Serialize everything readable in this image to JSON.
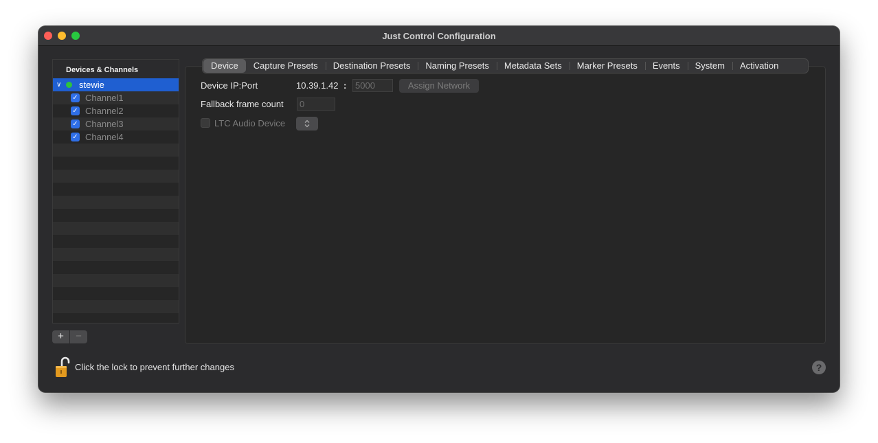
{
  "window": {
    "title": "Just Control Configuration"
  },
  "sidebar": {
    "header": "Devices & Channels",
    "device": {
      "name": "stewie",
      "status_color": "#2ec33c"
    },
    "channels": [
      "Channel1",
      "Channel2",
      "Channel3",
      "Channel4"
    ]
  },
  "tabs": [
    "Device",
    "Capture Presets",
    "Destination Presets",
    "Naming Presets",
    "Metadata Sets",
    "Marker Presets",
    "Events",
    "System",
    "Activation"
  ],
  "device": {
    "ip_label": "Device IP:Port",
    "ip_value": "10.39.1.42",
    "ip_separator": ":",
    "port_placeholder": "5000",
    "assign_network_label": "Assign Network",
    "fallback_label": "Fallback frame count",
    "fallback_placeholder": "0",
    "ltc_label": "LTC Audio Device"
  },
  "footer": {
    "lock_text": "Click the lock to prevent further changes",
    "help_label": "?"
  },
  "colors": {
    "accent": "#1f5fd1",
    "checkbox": "#2f6fe8"
  }
}
